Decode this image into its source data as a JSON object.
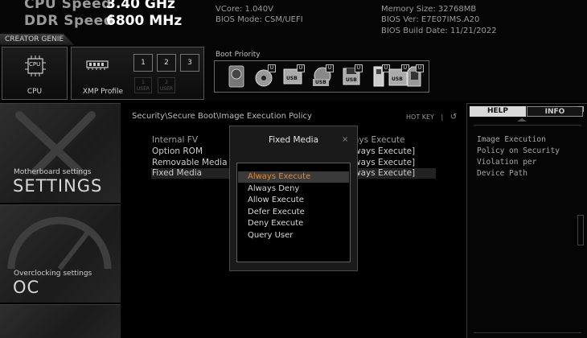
{
  "header": {
    "cpu_speed_label": "CPU Speed",
    "cpu_speed_value": "3.40 GHz",
    "ddr_speed_label": "DDR Speed",
    "ddr_speed_value": "6800 MHz",
    "mid_lines": [
      "VCore: 1.040V",
      "BIOS Mode: CSM/UEFI"
    ],
    "right_lines": [
      "Memory Size: 32768MB",
      "BIOS Ver: E7E07IMS.A20",
      "BIOS Build Date: 11/21/2022"
    ]
  },
  "creator_genie": {
    "label": "CREATOR GENIE",
    "cpu_tile_label": "CPU",
    "cpu_chip_text": "CPU",
    "xmp_tile_label": "XMP Profile",
    "xmp_buttons": [
      "1",
      "2",
      "3"
    ],
    "user_buttons": [
      "1\nUSER",
      "2\nUSER"
    ]
  },
  "boot": {
    "label": "Boot Priority",
    "devices": [
      {
        "icon": "hdd-icon",
        "tag": ""
      },
      {
        "icon": "optical-disc-icon",
        "tag": "U"
      },
      {
        "icon": "usb-drive-icon",
        "tag": "U",
        "text": "USB"
      },
      {
        "icon": "usb-optical-icon",
        "tag": "U",
        "text": "USB"
      },
      {
        "icon": "usb-floppy-icon",
        "tag": "U",
        "text": "USB"
      },
      {
        "icon": "usb-key-icon",
        "tag": "U"
      },
      {
        "icon": "usb-hdd-icon",
        "tag": "U",
        "text": "USB"
      },
      {
        "icon": "sd-card-icon",
        "tag": "U"
      }
    ]
  },
  "sidebar": {
    "settings_sub": "Motherboard settings",
    "settings_main": "SETTINGS",
    "oc_sub": "Overclocking settings",
    "oc_main": "OC"
  },
  "main": {
    "breadcrumb": "Security\\Secure Boot\\Image Execution Policy",
    "hotkey": "HOT KEY",
    "hotkey_sep": "|",
    "back_glyph": "↺",
    "rows": [
      {
        "label": "Internal FV",
        "value": "ays Execute"
      },
      {
        "label": "Option ROM",
        "value": "ways Execute]"
      },
      {
        "label": "Removable Media",
        "value": "ways Execute]"
      },
      {
        "label": "Fixed Media",
        "value": "ways Execute]"
      }
    ]
  },
  "modal": {
    "title": "Fixed Media",
    "close_glyph": "×",
    "options": [
      "Always Execute",
      "Always Deny",
      "Allow Execute",
      "Defer Execute",
      "Deny Execute",
      "Query User"
    ],
    "selected": "Always Execute"
  },
  "help": {
    "tab_help": "HELP",
    "tab_info": "INFO",
    "text_lines": [
      "Image Execution",
      "Policy on Security",
      "Violation per",
      "Device Path"
    ]
  },
  "colors": {
    "selected_option": "#e08a2e",
    "tab_active": "#d9d9d9"
  }
}
